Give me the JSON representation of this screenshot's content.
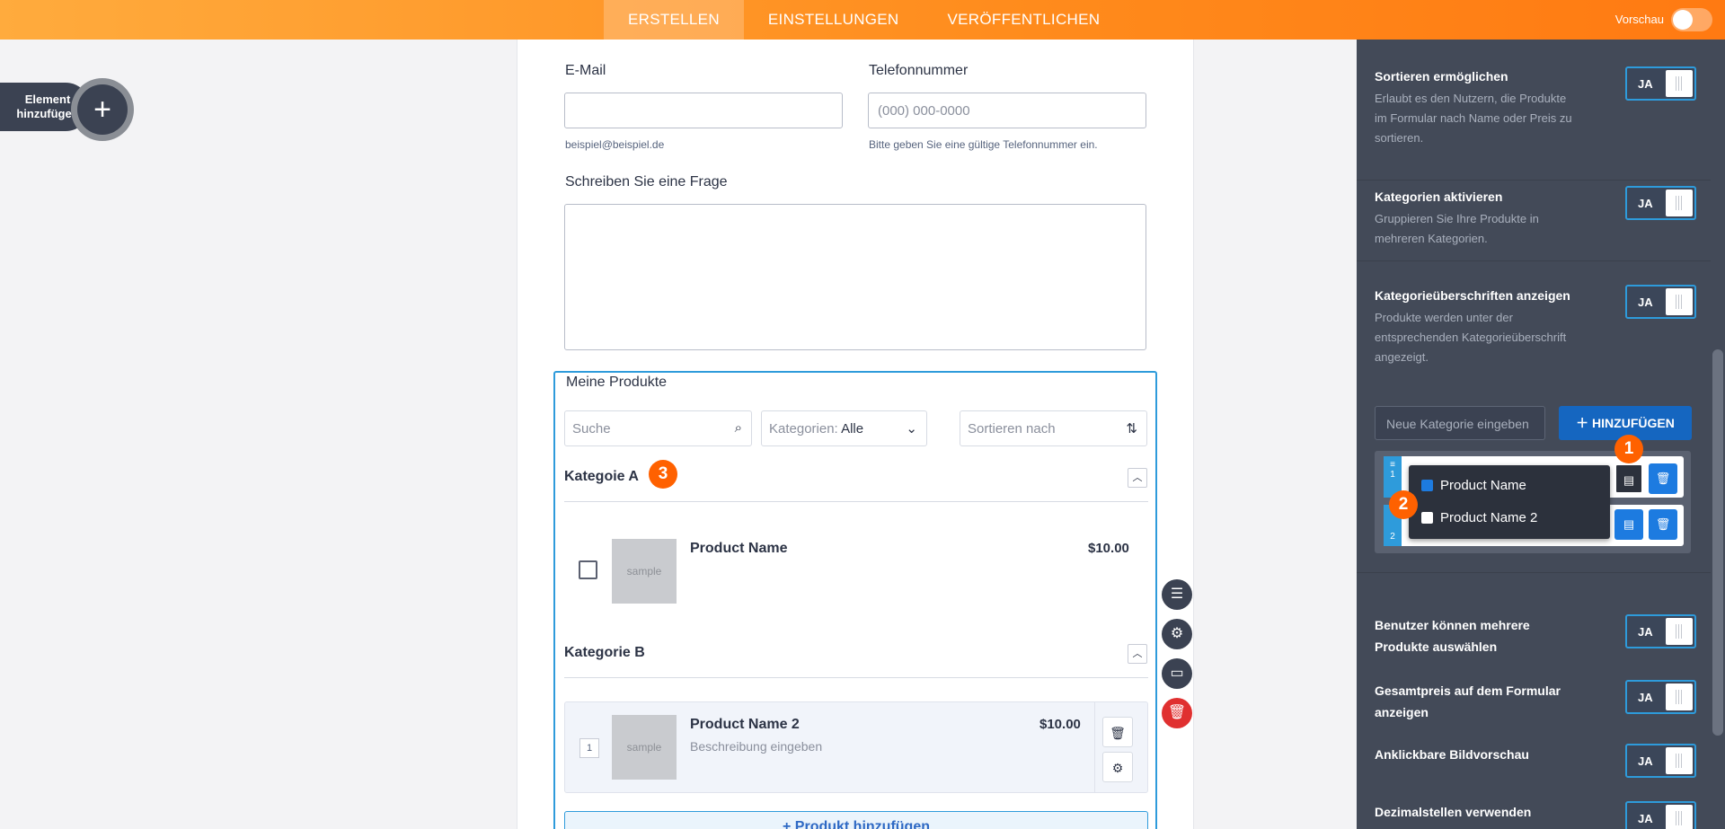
{
  "topbar": {
    "tabs": [
      "ERSTELLEN",
      "EINSTELLUNGEN",
      "VERÖFFENTLICHEN"
    ],
    "active_tab": "ERSTELLEN",
    "preview_label": "Vorschau"
  },
  "add_element": {
    "label_line1": "Element",
    "label_line2": "hinzufügen"
  },
  "form": {
    "email_label": "E-Mail",
    "email_hint": "beispiel@beispiel.de",
    "phone_label": "Telefonnummer",
    "phone_placeholder": "(000) 000-0000",
    "phone_hint": "Bitte geben Sie eine gültige Telefonnummer ein.",
    "question_label": "Schreiben Sie eine Frage"
  },
  "products": {
    "title": "Meine Produkte",
    "search_placeholder": "Suche",
    "categories_label": "Kategorien:",
    "categories_value": "Alle",
    "sort_placeholder": "Sortieren nach",
    "category_a": "Kategoie A",
    "category_b": "Kategorie B",
    "badge_3": "3",
    "item_a": {
      "name": "Product Name",
      "price": "$10.00",
      "image_text": "sample"
    },
    "item_b": {
      "name": "Product Name 2",
      "price": "$10.00",
      "image_text": "sample",
      "description": "Beschreibung eingeben",
      "qty": "1"
    },
    "add_product": "+ Produkt hinzufügen"
  },
  "panel": {
    "settings": [
      {
        "title": "Sortieren ermöglichen",
        "desc": "Erlaubt es den Nutzern, die Produkte im Formular nach Name oder Preis zu sortieren.",
        "toggle": "JA"
      },
      {
        "title": "Kategorien aktivieren",
        "desc": "Gruppieren Sie Ihre Produkte in mehreren Kategorien.",
        "toggle": "JA"
      },
      {
        "title": "Kategorieüberschriften anzeigen",
        "desc": "Produkte werden unter der entsprechenden Kategorieüberschrift angezeigt.",
        "toggle": "JA"
      },
      {
        "title": "Benutzer können mehrere Produkte auswählen",
        "toggle": "JA"
      },
      {
        "title": "Gesamtpreis auf dem Formular anzeigen",
        "toggle": "JA"
      },
      {
        "title": "Anklickbare Bildvorschau",
        "toggle": "JA"
      },
      {
        "title": "Dezimalstellen verwenden",
        "toggle": "JA"
      }
    ],
    "new_category_placeholder": "Neue Kategorie eingeben",
    "add_button": "HINZUFÜGEN",
    "category_rows": [
      "1",
      "2"
    ],
    "dropdown_items": [
      {
        "label": "Product Name",
        "checked": true
      },
      {
        "label": "Product Name 2",
        "checked": false
      }
    ],
    "badge_1": "1",
    "badge_2": "2"
  }
}
